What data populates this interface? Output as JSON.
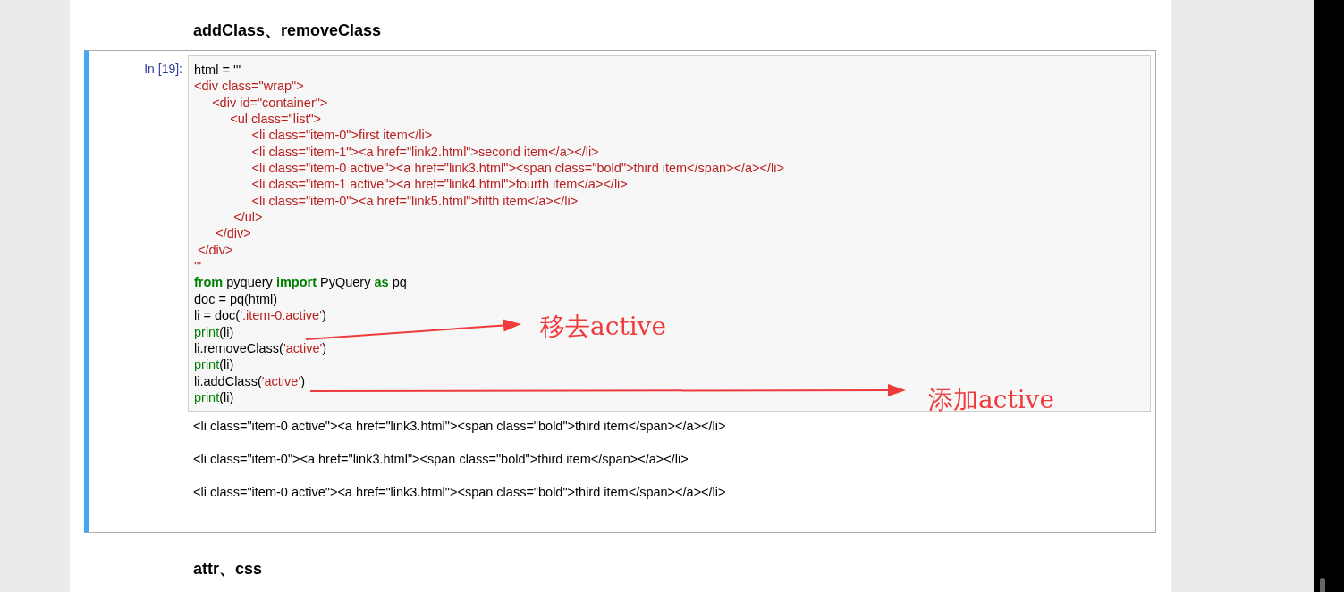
{
  "sections": [
    {
      "heading": "addClass、removeClass",
      "cell": {
        "selected": true,
        "prompt": "In [19]:",
        "code": [
          [
            {
              "kind": "plain",
              "text": "html = "
            },
            {
              "kind": "plain",
              "text": "'''"
            }
          ],
          [
            {
              "kind": "string",
              "text": "<div class=\"wrap\">"
            }
          ],
          [
            {
              "kind": "string",
              "text": "     <div id=\"container\">"
            }
          ],
          [
            {
              "kind": "string",
              "text": "          <ul class=\"list\">"
            }
          ],
          [
            {
              "kind": "string",
              "text": "                <li class=\"item-0\">first item</li>"
            }
          ],
          [
            {
              "kind": "string",
              "text": "                <li class=\"item-1\"><a href=\"link2.html\">second item</a></li>"
            }
          ],
          [
            {
              "kind": "string",
              "text": "                <li class=\"item-0 active\"><a href=\"link3.html\"><span class=\"bold\">third item</span></a></li>"
            }
          ],
          [
            {
              "kind": "string",
              "text": "                <li class=\"item-1 active\"><a href=\"link4.html\">fourth item</a></li>"
            }
          ],
          [
            {
              "kind": "string",
              "text": "                <li class=\"item-0\"><a href=\"link5.html\">fifth item</a></li>"
            }
          ],
          [
            {
              "kind": "string",
              "text": "           </ul>"
            }
          ],
          [
            {
              "kind": "string",
              "text": "      </div>"
            }
          ],
          [
            {
              "kind": "string",
              "text": " </div>"
            }
          ],
          [
            {
              "kind": "string",
              "text": "'''"
            }
          ],
          [
            {
              "kind": "keyword",
              "text": "from"
            },
            {
              "kind": "plain",
              "text": " pyquery "
            },
            {
              "kind": "keyword",
              "text": "import"
            },
            {
              "kind": "plain",
              "text": " PyQuery "
            },
            {
              "kind": "keyword",
              "text": "as"
            },
            {
              "kind": "plain",
              "text": " pq"
            }
          ],
          [
            {
              "kind": "plain",
              "text": "doc = pq(html)"
            }
          ],
          [
            {
              "kind": "plain",
              "text": "li = doc("
            },
            {
              "kind": "string",
              "text": "'.item-0.active'"
            },
            {
              "kind": "plain",
              "text": ")"
            }
          ],
          [
            {
              "kind": "builtin",
              "text": "print"
            },
            {
              "kind": "plain",
              "text": "(li)"
            }
          ],
          [
            {
              "kind": "plain",
              "text": "li.removeClass("
            },
            {
              "kind": "string",
              "text": "'active'"
            },
            {
              "kind": "plain",
              "text": ")"
            }
          ],
          [
            {
              "kind": "builtin",
              "text": "print"
            },
            {
              "kind": "plain",
              "text": "(li)"
            }
          ],
          [
            {
              "kind": "plain",
              "text": "li.addClass("
            },
            {
              "kind": "string",
              "text": "'active'"
            },
            {
              "kind": "plain",
              "text": ")"
            }
          ],
          [
            {
              "kind": "builtin",
              "text": "print"
            },
            {
              "kind": "plain",
              "text": "(li)"
            }
          ]
        ],
        "outputs": [
          "<li class=\"item-0 active\"><a href=\"link3.html\"><span class=\"bold\">third item</span></a></li>",
          "<li class=\"item-0\"><a href=\"link3.html\"><span class=\"bold\">third item</span></a></li>",
          "<li class=\"item-0 active\"><a href=\"link3.html\"><span class=\"bold\">third item</span></a></li>"
        ],
        "annotations": [
          {
            "text": "移去active"
          },
          {
            "text": "添加active"
          }
        ]
      }
    },
    {
      "heading": "attr、css"
    }
  ]
}
